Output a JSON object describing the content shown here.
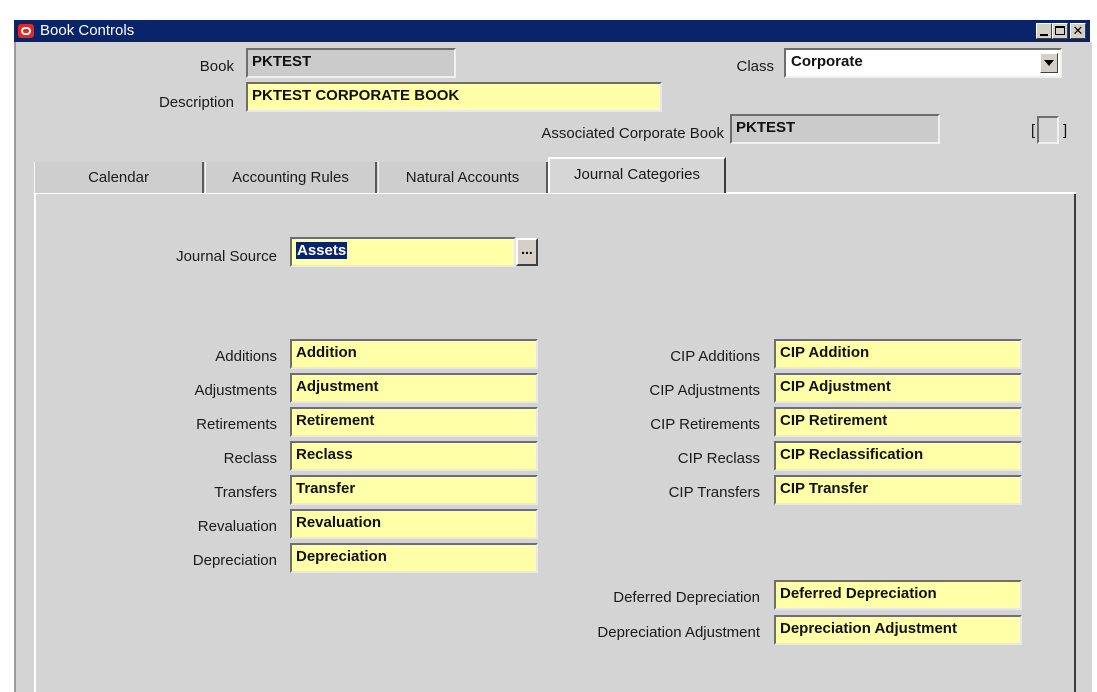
{
  "window": {
    "title": "Book Controls"
  },
  "header": {
    "book_label": "Book",
    "book_value": "PKTEST",
    "class_label": "Class",
    "class_value": "Corporate",
    "description_label": "Description",
    "description_value": "PKTEST CORPORATE BOOK",
    "assoc_label": "Associated Corporate Book",
    "assoc_value": "PKTEST",
    "dff_left": "[",
    "dff_right": "]"
  },
  "tabs": [
    {
      "label": "Calendar",
      "active": false
    },
    {
      "label": "Accounting Rules",
      "active": false
    },
    {
      "label": "Natural Accounts",
      "active": false
    },
    {
      "label": "Journal Categories",
      "active": true
    }
  ],
  "journal": {
    "source_label": "Journal Source",
    "source_value": "Assets",
    "lov_button": "...",
    "left": [
      {
        "label": "Additions",
        "value": "Addition"
      },
      {
        "label": "Adjustments",
        "value": "Adjustment"
      },
      {
        "label": "Retirements",
        "value": "Retirement"
      },
      {
        "label": "Reclass",
        "value": "Reclass"
      },
      {
        "label": "Transfers",
        "value": "Transfer"
      },
      {
        "label": "Revaluation",
        "value": "Revaluation"
      },
      {
        "label": "Depreciation",
        "value": "Depreciation"
      }
    ],
    "right": [
      {
        "label": "CIP Additions",
        "value": "CIP Addition"
      },
      {
        "label": "CIP Adjustments",
        "value": "CIP Adjustment"
      },
      {
        "label": "CIP Retirements",
        "value": "CIP Retirement"
      },
      {
        "label": "CIP Reclass",
        "value": "CIP Reclassification"
      },
      {
        "label": "CIP Transfers",
        "value": "CIP Transfer"
      }
    ],
    "deferred": [
      {
        "label": "Deferred Depreciation",
        "value": "Deferred Depreciation"
      },
      {
        "label": "Depreciation Adjustment",
        "value": "Depreciation Adjustment"
      }
    ]
  },
  "colors": {
    "titlebar": "#0a246a",
    "field_yellow": "#ffffa8",
    "canvas": "#d4d4d4",
    "selection": "#0a246a"
  }
}
